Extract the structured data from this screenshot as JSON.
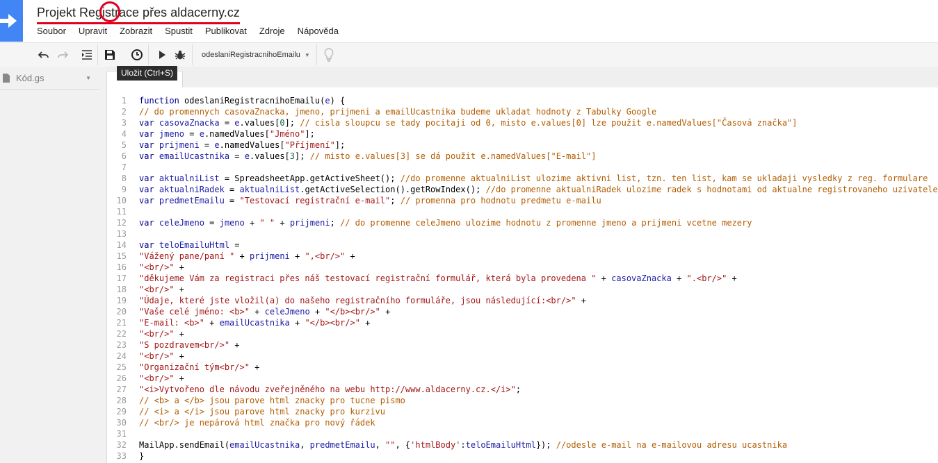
{
  "app": {
    "title": "Projekt Registrace přes aldacerny.cz",
    "menu": [
      "Soubor",
      "Upravit",
      "Zobrazit",
      "Spustit",
      "Publikovat",
      "Zdroje",
      "Nápověda"
    ]
  },
  "toolbar": {
    "function_select": "odeslaniRegistracnihoEmailu",
    "tooltip": "Uložit (Ctrl+S)"
  },
  "sidebar": {
    "file_name": "Kód.gs"
  },
  "colors": {
    "accent_red": "#e0001b",
    "logo_blue": "#4285f4",
    "keyword": "#00008b",
    "variable": "#1a1aa6",
    "string": "#a31515",
    "comment": "#b35c00"
  },
  "code_lines": [
    {
      "n": "1",
      "t": [
        [
          "kw",
          "function "
        ],
        [
          "def",
          "odeslaniRegistracnihoEmailu("
        ],
        [
          "var",
          "e"
        ],
        [
          "def",
          ") {"
        ]
      ]
    },
    {
      "n": "2",
      "t": [
        [
          "com",
          "// do promennych casovaZnacka, jmeno, prijmeni a emailUcastnika budeme ukladat hodnoty z Tabulky Google"
        ]
      ]
    },
    {
      "n": "3",
      "t": [
        [
          "kw",
          "var "
        ],
        [
          "var",
          "casovaZnacka"
        ],
        [
          "def",
          " = "
        ],
        [
          "var",
          "e"
        ],
        [
          "def",
          ".values["
        ],
        [
          "num",
          "0"
        ],
        [
          "def",
          "]; "
        ],
        [
          "com",
          "// cisla sloupcu se tady pocitaji od 0, misto e.values[0] lze použit e.namedValues[\"Časová značka\"]"
        ]
      ]
    },
    {
      "n": "4",
      "t": [
        [
          "kw",
          "var "
        ],
        [
          "var",
          "jmeno"
        ],
        [
          "def",
          " = "
        ],
        [
          "var",
          "e"
        ],
        [
          "def",
          ".namedValues["
        ],
        [
          "str",
          "\"Jméno\""
        ],
        [
          "def",
          "];"
        ]
      ]
    },
    {
      "n": "5",
      "t": [
        [
          "kw",
          "var "
        ],
        [
          "var",
          "prijmeni"
        ],
        [
          "def",
          " = "
        ],
        [
          "var",
          "e"
        ],
        [
          "def",
          ".namedValues["
        ],
        [
          "str",
          "\"Příjmení\""
        ],
        [
          "def",
          "];"
        ]
      ]
    },
    {
      "n": "6",
      "t": [
        [
          "kw",
          "var "
        ],
        [
          "var",
          "emailUcastnika"
        ],
        [
          "def",
          " = "
        ],
        [
          "var",
          "e"
        ],
        [
          "def",
          ".values["
        ],
        [
          "num",
          "3"
        ],
        [
          "def",
          "]; "
        ],
        [
          "com",
          "// misto e.values[3] se dá použit e.namedValues[\"E-mail\"]"
        ]
      ]
    },
    {
      "n": "7",
      "t": []
    },
    {
      "n": "8",
      "t": [
        [
          "kw",
          "var "
        ],
        [
          "var",
          "aktualniList"
        ],
        [
          "def",
          " = SpreadsheetApp.getActiveSheet(); "
        ],
        [
          "com",
          "//do promenne aktualniList ulozime aktivni list, tzn. ten list, kam se ukladaji vysledky z reg. formulare"
        ]
      ]
    },
    {
      "n": "9",
      "t": [
        [
          "kw",
          "var "
        ],
        [
          "var",
          "aktualniRadek"
        ],
        [
          "def",
          " = "
        ],
        [
          "var",
          "aktualniList"
        ],
        [
          "def",
          ".getActiveSelection().getRowIndex(); "
        ],
        [
          "com",
          "//do promenne aktualniRadek ulozime radek s hodnotami od aktualne registrovaneho uzivatele"
        ]
      ]
    },
    {
      "n": "10",
      "t": [
        [
          "kw",
          "var "
        ],
        [
          "var",
          "predmetEmailu"
        ],
        [
          "def",
          " = "
        ],
        [
          "str",
          "\"Testovací registrační e-mail\""
        ],
        [
          "def",
          "; "
        ],
        [
          "com",
          "// promenna pro hodnotu predmetu e-mailu"
        ]
      ]
    },
    {
      "n": "11",
      "t": []
    },
    {
      "n": "12",
      "t": [
        [
          "kw",
          "var "
        ],
        [
          "var",
          "celeJmeno"
        ],
        [
          "def",
          " = "
        ],
        [
          "var",
          "jmeno"
        ],
        [
          "def",
          " + "
        ],
        [
          "str",
          "\" \""
        ],
        [
          "def",
          " + "
        ],
        [
          "var",
          "prijmeni"
        ],
        [
          "def",
          "; "
        ],
        [
          "com",
          "// do promenne celeJmeno ulozime hodnotu z promenne jmeno a prijmeni vcetne mezery"
        ]
      ]
    },
    {
      "n": "13",
      "t": []
    },
    {
      "n": "14",
      "t": [
        [
          "kw",
          "var "
        ],
        [
          "var",
          "teloEmailuHtml"
        ],
        [
          "def",
          " ="
        ]
      ]
    },
    {
      "n": "15",
      "t": [
        [
          "str",
          "\"Vážený pane/paní \""
        ],
        [
          "def",
          " + "
        ],
        [
          "var",
          "prijmeni"
        ],
        [
          "def",
          " + "
        ],
        [
          "str",
          "\",<br/>\""
        ],
        [
          "def",
          " +"
        ]
      ]
    },
    {
      "n": "16",
      "t": [
        [
          "str",
          "\"<br/>\""
        ],
        [
          "def",
          " +"
        ]
      ]
    },
    {
      "n": "17",
      "t": [
        [
          "str",
          "\"děkujeme Vám za registraci přes náš testovací registrační formulář, která byla provedena \""
        ],
        [
          "def",
          " + "
        ],
        [
          "var",
          "casovaZnacka"
        ],
        [
          "def",
          " + "
        ],
        [
          "str",
          "\".<br/>\""
        ],
        [
          "def",
          " +"
        ]
      ]
    },
    {
      "n": "18",
      "t": [
        [
          "str",
          "\"<br/>\""
        ],
        [
          "def",
          " +"
        ]
      ]
    },
    {
      "n": "19",
      "t": [
        [
          "str",
          "\"Údaje, které jste vložil(a) do našeho registračního formuláře, jsou následující:<br/>\""
        ],
        [
          "def",
          " +"
        ]
      ]
    },
    {
      "n": "20",
      "t": [
        [
          "str",
          "\"Vaše celé jméno: <b>\""
        ],
        [
          "def",
          " + "
        ],
        [
          "var",
          "celeJmeno"
        ],
        [
          "def",
          " + "
        ],
        [
          "str",
          "\"</b><br/>\""
        ],
        [
          "def",
          " +"
        ]
      ]
    },
    {
      "n": "21",
      "t": [
        [
          "str",
          "\"E-mail: <b>\""
        ],
        [
          "def",
          " + "
        ],
        [
          "var",
          "emailUcastnika"
        ],
        [
          "def",
          " + "
        ],
        [
          "str",
          "\"</b><br/>\""
        ],
        [
          "def",
          " +"
        ]
      ]
    },
    {
      "n": "22",
      "t": [
        [
          "str",
          "\"<br/>\""
        ],
        [
          "def",
          " +"
        ]
      ]
    },
    {
      "n": "23",
      "t": [
        [
          "str",
          "\"S pozdravem<br/>\""
        ],
        [
          "def",
          " +"
        ]
      ]
    },
    {
      "n": "24",
      "t": [
        [
          "str",
          "\"<br/>\""
        ],
        [
          "def",
          " +"
        ]
      ]
    },
    {
      "n": "25",
      "t": [
        [
          "str",
          "\"Organizační tým<br/>\""
        ],
        [
          "def",
          " +"
        ]
      ]
    },
    {
      "n": "26",
      "t": [
        [
          "str",
          "\"<br/>\""
        ],
        [
          "def",
          " +"
        ]
      ]
    },
    {
      "n": "27",
      "t": [
        [
          "str",
          "\"<i>Vytvořeno dle návodu zveřejněného na webu http://www.aldacerny.cz.</i>\""
        ],
        [
          "def",
          ";"
        ]
      ]
    },
    {
      "n": "28",
      "t": [
        [
          "com",
          "// <b> a </b> jsou parove html znacky pro tucne pismo"
        ]
      ]
    },
    {
      "n": "29",
      "t": [
        [
          "com",
          "// <i> a </i> jsou parove html znacky pro kurzivu"
        ]
      ]
    },
    {
      "n": "30",
      "t": [
        [
          "com",
          "// <br/> je nepárová html značka pro nový řádek"
        ]
      ]
    },
    {
      "n": "31",
      "t": []
    },
    {
      "n": "32",
      "t": [
        [
          "def",
          "MailApp.sendEmail("
        ],
        [
          "var",
          "emailUcastnika"
        ],
        [
          "def",
          ", "
        ],
        [
          "var",
          "predmetEmailu"
        ],
        [
          "def",
          ", "
        ],
        [
          "str",
          "\"\""
        ],
        [
          "def",
          ", {"
        ],
        [
          "str",
          "'htmlBody'"
        ],
        [
          "def",
          ":"
        ],
        [
          "var",
          "teloEmailuHtml"
        ],
        [
          "def",
          "}); "
        ],
        [
          "com",
          "//odesle e-mail na e-mailovou adresu ucastnika"
        ]
      ]
    },
    {
      "n": "33",
      "t": [
        [
          "def",
          "}"
        ]
      ]
    }
  ]
}
